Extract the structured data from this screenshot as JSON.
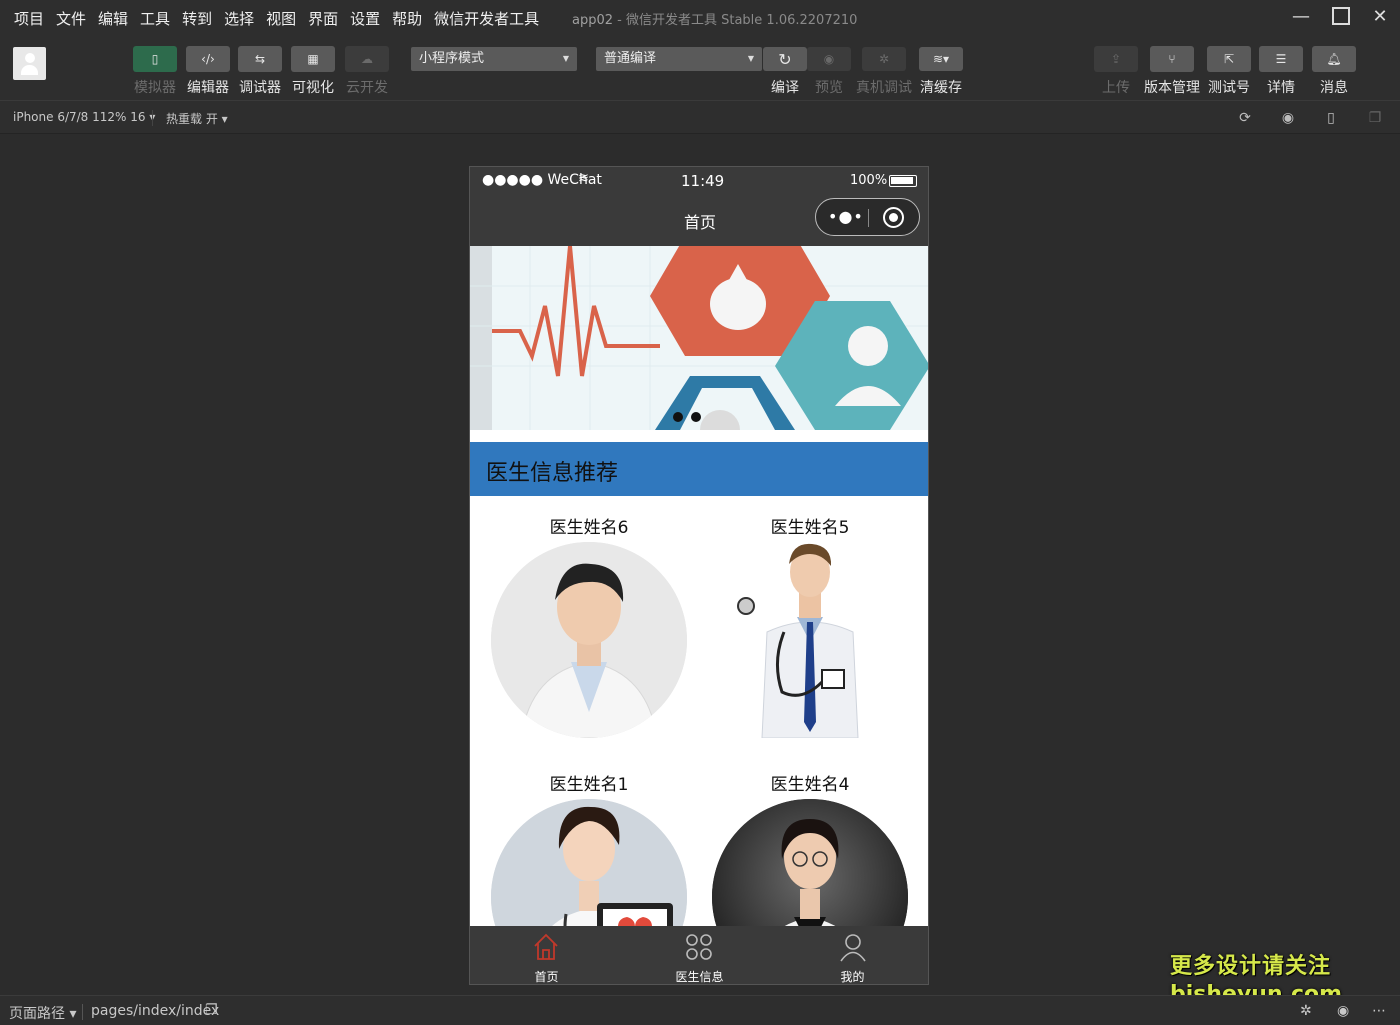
{
  "menubar": {
    "items": [
      "项目",
      "文件",
      "编辑",
      "工具",
      "转到",
      "选择",
      "视图",
      "界面",
      "设置",
      "帮助",
      "微信开发者工具"
    ],
    "title_app": "app02",
    "title_main": "微信开发者工具 Stable 1.06.2207210"
  },
  "toolbar": {
    "left_buttons": [
      {
        "label": "模拟器",
        "icon": "phone-icon",
        "state": "active"
      },
      {
        "label": "编辑器",
        "icon": "code-icon",
        "state": "normal"
      },
      {
        "label": "调试器",
        "icon": "debugger-icon",
        "state": "normal"
      },
      {
        "label": "可视化",
        "icon": "layout-icon",
        "state": "normal"
      },
      {
        "label": "云开发",
        "icon": "cloud-icon",
        "state": "disabled"
      }
    ],
    "mode_select": "小程序模式",
    "compile_select": "普通编译",
    "mid_buttons": [
      {
        "label": "编译",
        "icon": "refresh-icon",
        "state": "normal"
      },
      {
        "label": "预览",
        "icon": "eye-icon",
        "state": "disabled"
      },
      {
        "label": "真机调试",
        "icon": "bug-icon",
        "state": "disabled"
      },
      {
        "label": "清缓存",
        "icon": "layers-icon",
        "state": "normal"
      }
    ],
    "right_buttons": [
      {
        "label": "上传",
        "icon": "upload-icon",
        "state": "disabled"
      },
      {
        "label": "版本管理",
        "icon": "branch-icon",
        "state": "normal"
      },
      {
        "label": "测试号",
        "icon": "external-icon",
        "state": "normal"
      },
      {
        "label": "详情",
        "icon": "menu-icon",
        "state": "normal"
      },
      {
        "label": "消息",
        "icon": "bell-icon",
        "state": "normal"
      }
    ]
  },
  "subbar": {
    "device": "iPhone 6/7/8 112% 16 ▾",
    "hotreload": "热重载 开 ▾"
  },
  "phone": {
    "carrier": "●●●●● WeChat",
    "time": "11:49",
    "battery": "100%",
    "nav_title": "首页",
    "section_title": "医生信息推荐",
    "doctors": [
      {
        "name": "医生姓名6"
      },
      {
        "name": "医生姓名5"
      },
      {
        "name": "医生姓名1"
      },
      {
        "name": "医生姓名4"
      }
    ],
    "tabs": [
      {
        "label": "首页",
        "icon": "home-icon",
        "active": true
      },
      {
        "label": "医生信息",
        "icon": "grid-icon",
        "active": false
      },
      {
        "label": "我的",
        "icon": "user-icon",
        "active": false
      }
    ]
  },
  "statusline": {
    "path_label": "页面路径 ▾",
    "path": "pages/index/index"
  },
  "watermark": {
    "line1": "更多设计请关注",
    "line2": "bisheyun.com"
  },
  "colors": {
    "accent_green": "#2d6b4c",
    "section_blue": "#3078be",
    "tab_active_red": "#c0392b"
  }
}
